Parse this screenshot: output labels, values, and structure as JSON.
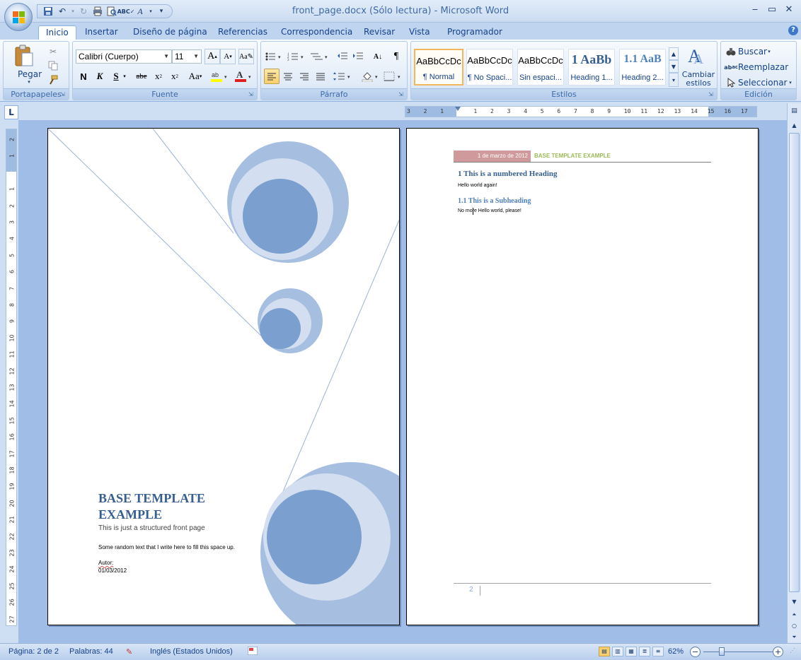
{
  "window": {
    "title": "front_page.docx (Sólo lectura) - Microsoft Word",
    "minimize": "‒",
    "maximize": "▭",
    "close": "✕"
  },
  "tabs": [
    {
      "label": "Inicio",
      "active": true
    },
    {
      "label": "Insertar"
    },
    {
      "label": "Diseño de página"
    },
    {
      "label": "Referencias"
    },
    {
      "label": "Correspondencia"
    },
    {
      "label": "Revisar"
    },
    {
      "label": "Vista"
    },
    {
      "label": "Programador"
    }
  ],
  "ribbon": {
    "clipboard": {
      "label": "Portapapeles",
      "paste": "Pegar"
    },
    "font": {
      "label": "Fuente",
      "font_name": "Calibri (Cuerpo)",
      "font_size": "11"
    },
    "paragraph": {
      "label": "Párrafo"
    },
    "styles": {
      "label": "Estilos",
      "items": [
        {
          "sample": "AaBbCcDc",
          "name": "¶ Normal",
          "selected": true
        },
        {
          "sample": "AaBbCcDc",
          "name": "¶ No Spaci..."
        },
        {
          "sample": "AaBbCcDc",
          "name": "Sin espaci..."
        },
        {
          "sample": "1  AaBb",
          "name": "Heading 1..."
        },
        {
          "sample": "1.1  AaB",
          "name": "Heading 2..."
        }
      ],
      "change": "Cambiar estilos"
    },
    "editing": {
      "label": "Edición",
      "find": "Buscar",
      "replace": "Reemplazar",
      "select": "Seleccionar"
    }
  },
  "document": {
    "page1": {
      "title": "BASE TEMPLATE EXAMPLE",
      "subtitle": "This is just a structured front page",
      "body": "Some random text that I write here to fill this space up.",
      "author": "Autor:",
      "date": "01/03/2012"
    },
    "page2": {
      "header_date": "1 de marzo de 2012",
      "header_title": "BASE TEMPLATE EXAMPLE",
      "heading1": "1    This is a numbered Heading",
      "para1": "Hello world again!",
      "heading2": "1.1   This is a  Subheading",
      "para2": "No more Hello world, please!",
      "page_number": "2"
    }
  },
  "status": {
    "page": "Página: 2 de 2",
    "words": "Palabras: 44",
    "language": "Inglés (Estados Unidos)",
    "zoom": "62%"
  },
  "colors": {
    "heading": "#365f91",
    "accent": "#4f81bd",
    "header_band": "#d0999b",
    "header_title": "#9bbb59",
    "circle_light": "#a6bfe0",
    "circle_mid": "#d3dff0",
    "circle_dark": "#7ba0d0"
  }
}
